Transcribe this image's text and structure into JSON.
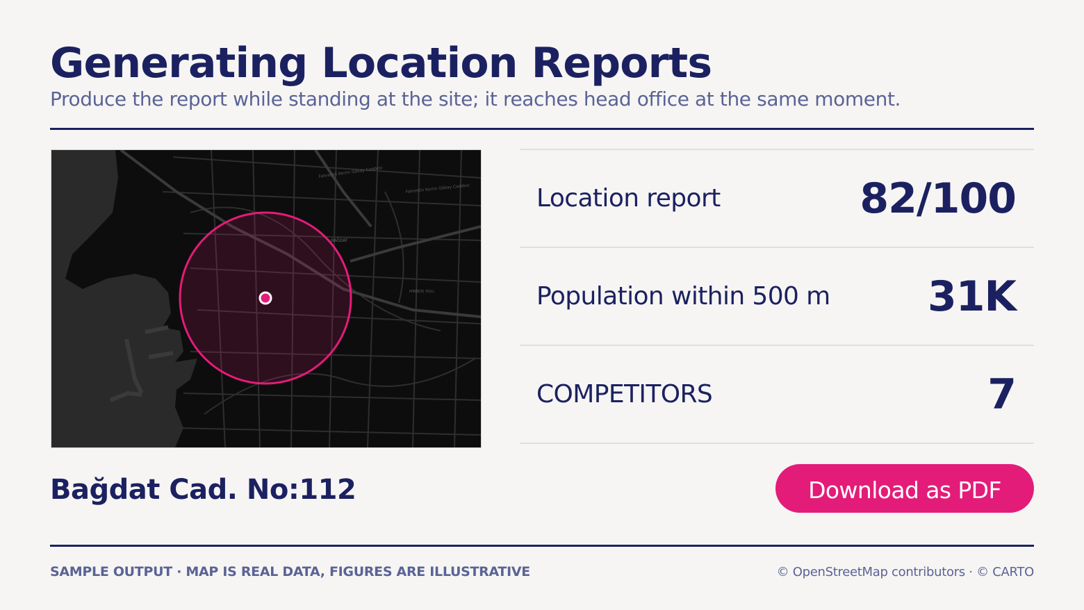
{
  "header": {
    "title": "Generating Location Reports",
    "subtitle": "Produce the report while standing at the site; it reaches head office at the same moment."
  },
  "map": {
    "street_labels": [
      "Fahrettin Kerim Gökay Caddesi",
      "Fahrettin Kerim Gökay Caddesi",
      "BAĞDAT",
      "MİNİBÜS YOLU"
    ],
    "colors": {
      "land": "#0d0d0d",
      "water": "#2a2a2a",
      "roads": "#2b2b2b",
      "accent": "#e31c79"
    }
  },
  "site": {
    "address": "Bağdat Cad. No:112"
  },
  "stats": [
    {
      "label": "Location report",
      "value": "82/100"
    },
    {
      "label": "Population within 500 m",
      "value": "31K"
    },
    {
      "label": "COMPETITORS",
      "value": "7"
    }
  ],
  "actions": {
    "download_label": "Download as PDF"
  },
  "footer": {
    "note": "SAMPLE OUTPUT · MAP IS REAL DATA, FIGURES ARE ILLUSTRATIVE",
    "attribution": "© OpenStreetMap contributors · © CARTO"
  },
  "colors": {
    "navy": "#1b2160",
    "muted": "#5a6396",
    "accent": "#e31c79",
    "background": "#f6f5f3"
  }
}
